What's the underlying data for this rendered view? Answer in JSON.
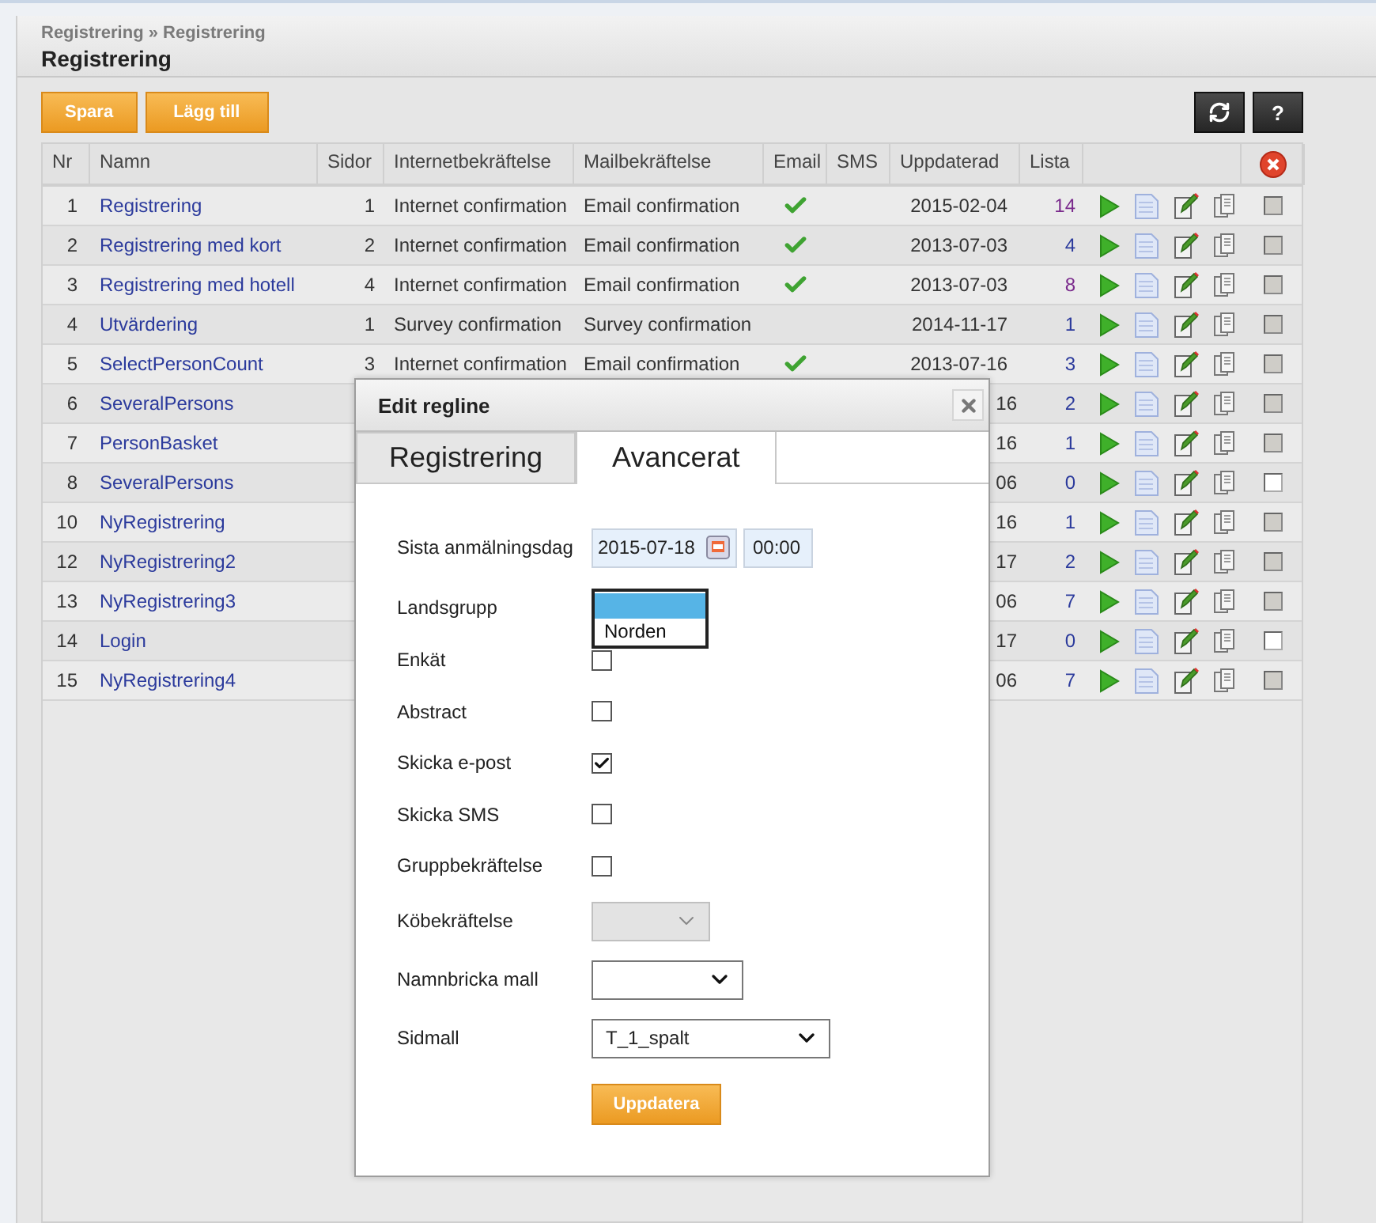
{
  "header": {
    "breadcrumb": "Registrering » Registrering",
    "title": "Registrering"
  },
  "buttons": [
    {
      "label": "Spara"
    },
    {
      "label": "Lägg till"
    }
  ],
  "help_button": {
    "label": "?"
  },
  "table": {
    "columns": [
      "Nr",
      "Namn",
      "Sidor",
      "Internetbekräftelse",
      "Mailbekräftelse",
      "Email",
      "SMS",
      "Uppdaterad",
      "Lista"
    ],
    "rows": [
      {
        "nr": "1",
        "name": "Registrering",
        "pages": "1",
        "internet": "Internet confirmation",
        "mail": "Email confirmation",
        "email": true,
        "updated": "2015-02-04",
        "list": "14",
        "visited": true,
        "disabled": true
      },
      {
        "nr": "2",
        "name": "Registrering med kort",
        "pages": "2",
        "internet": "Internet confirmation",
        "mail": "Email confirmation",
        "email": true,
        "updated": "2013-07-03",
        "list": "4",
        "visited": false,
        "disabled": true
      },
      {
        "nr": "3",
        "name": "Registrering med hotell",
        "pages": "4",
        "internet": "Internet confirmation",
        "mail": "Email confirmation",
        "email": true,
        "updated": "2013-07-03",
        "list": "8",
        "visited": true,
        "disabled": true
      },
      {
        "nr": "4",
        "name": "Utvärdering",
        "pages": "1",
        "internet": "Survey confirmation",
        "mail": "Survey confirmation",
        "email": false,
        "updated": "2014-11-17",
        "list": "1",
        "visited": false,
        "disabled": true
      },
      {
        "nr": "5",
        "name": "SelectPersonCount",
        "pages": "3",
        "internet": "Internet confirmation",
        "mail": "Email confirmation",
        "email": true,
        "updated": "2013-07-16",
        "list": "3",
        "visited": false,
        "disabled": true
      },
      {
        "nr": "6",
        "name": "SeveralPersons",
        "updated": "16",
        "list": "2",
        "visited": false,
        "disabled": true
      },
      {
        "nr": "7",
        "name": "PersonBasket",
        "updated": "16",
        "list": "1",
        "visited": false,
        "disabled": true
      },
      {
        "nr": "8",
        "name": "SeveralPersons",
        "updated": "06",
        "list": "0",
        "visited": false,
        "disabled": false
      },
      {
        "nr": "10",
        "name": "NyRegistrering",
        "updated": "16",
        "list": "1",
        "visited": false,
        "disabled": true
      },
      {
        "nr": "12",
        "name": "NyRegistrering2",
        "updated": "17",
        "list": "2",
        "visited": false,
        "disabled": true
      },
      {
        "nr": "13",
        "name": "NyRegistrering3",
        "updated": "06",
        "list": "7",
        "visited": false,
        "disabled": true
      },
      {
        "nr": "14",
        "name": "Login",
        "updated": "17",
        "list": "0",
        "visited": false,
        "disabled": false
      },
      {
        "nr": "15",
        "name": "NyRegistrering4",
        "updated": "06",
        "list": "7",
        "visited": false,
        "disabled": true
      }
    ]
  },
  "dialog": {
    "title": "Edit regline",
    "tabs": [
      {
        "label": "Registrering",
        "selected": false
      },
      {
        "label": "Avancerat",
        "selected": true
      }
    ],
    "fields": [
      {
        "kind": "datetime",
        "label": "Sista anmälningsdag",
        "date": "2015-07-18",
        "time": "00:00"
      },
      {
        "kind": "listbox",
        "label": "Landsgrupp",
        "options": [
          {
            "selected": true
          },
          {
            "label": "Norden",
            "selected": false
          }
        ]
      },
      {
        "kind": "checkbox",
        "label": "Enkät",
        "checked": false
      },
      {
        "kind": "checkbox",
        "label": "Abstract",
        "checked": false
      },
      {
        "kind": "checkbox",
        "label": "Skicka e-post",
        "checked": true
      },
      {
        "kind": "checkbox",
        "label": "Skicka SMS",
        "checked": false
      },
      {
        "kind": "checkbox",
        "label": "Gruppbekräftelse",
        "checked": false
      },
      {
        "kind": "select",
        "label": "Köbekräftelse",
        "disabled": true
      },
      {
        "kind": "select",
        "label": "Namnbricka mall",
        "disabled": false
      },
      {
        "kind": "select",
        "label": "Sidmall",
        "value": "T_1_spalt",
        "disabled": false
      }
    ],
    "submit": "Uppdatera"
  }
}
